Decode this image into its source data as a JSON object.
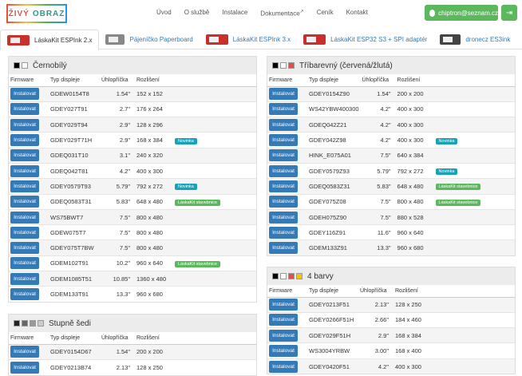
{
  "logo": {
    "part1": "ŽIVÝ",
    "part2": "OBRAZ"
  },
  "nav": [
    {
      "label": "Úvod"
    },
    {
      "label": "O službě"
    },
    {
      "label": "Instalace"
    },
    {
      "label": "Dokumentace",
      "external": true
    },
    {
      "label": "Ceník"
    },
    {
      "label": "Kontakt"
    }
  ],
  "user": {
    "email": "chiptron@seznam.cz"
  },
  "tabs": [
    {
      "label": "LáskaKit ESPInk 2.x",
      "board": "red",
      "active": true
    },
    {
      "label": "Pájeníčko Paperboard",
      "board": "gray"
    },
    {
      "label": "LáskaKit ESPInk 3.x",
      "board": "red"
    },
    {
      "label": "LáskaKit ESP32 S3 + SPI adaptér",
      "board": "red"
    },
    {
      "label": "dronecz ES3ink",
      "board": "dark"
    }
  ],
  "headers": {
    "firmware": "Firmware",
    "type": "Typ displeje",
    "diag": "Úhlopříčka",
    "res": "Rozlišení"
  },
  "install_label": "Instalovat",
  "panels": [
    {
      "id": "bw",
      "title": "Černobílý",
      "swatches": [
        "#000",
        "#fff"
      ],
      "rows": [
        {
          "type": "GDEW0154T8",
          "diag": "1.54\"",
          "res": "152 x 152",
          "badge": ""
        },
        {
          "type": "GDEY027T91",
          "diag": "2.7\"",
          "res": "176 x 264",
          "badge": ""
        },
        {
          "type": "GDEY029T94",
          "diag": "2.9\"",
          "res": "128 x 296",
          "badge": ""
        },
        {
          "type": "GDEY029T71H",
          "diag": "2.9\"",
          "res": "168 x 384",
          "badge": "Novinka"
        },
        {
          "type": "GDEQ031T10",
          "diag": "3.1\"",
          "res": "240 x 320",
          "badge": ""
        },
        {
          "type": "GDEQ042T81",
          "diag": "4.2\"",
          "res": "400 x 300",
          "badge": ""
        },
        {
          "type": "GDEY0579T93",
          "diag": "5.79\"",
          "res": "792 x 272",
          "badge": "Novinka"
        },
        {
          "type": "GDEQ0583T31",
          "diag": "5.83\"",
          "res": "648 x 480",
          "badge": "LáskaKit stavebnice"
        },
        {
          "type": "WS75BWT7",
          "diag": "7.5\"",
          "res": "800 x 480",
          "badge": ""
        },
        {
          "type": "GDEW075T7",
          "diag": "7.5\"",
          "res": "800 x 480",
          "badge": ""
        },
        {
          "type": "GDEY075T7BW",
          "diag": "7.5\"",
          "res": "800 x 480",
          "badge": ""
        },
        {
          "type": "GDEM102T91",
          "diag": "10.2\"",
          "res": "960 x 640",
          "badge": "LáskaKit stavebnice"
        },
        {
          "type": "GDEM1085T51",
          "diag": "10.85\"",
          "res": "1360 x 480",
          "badge": ""
        },
        {
          "type": "GDEM133T91",
          "diag": "13.3\"",
          "res": "960 x 680",
          "badge": ""
        }
      ]
    },
    {
      "id": "gray",
      "title": "Stupně šedi",
      "swatches": [
        "#222",
        "#666",
        "#999",
        "#ccc"
      ],
      "rows": [
        {
          "type": "GDEY0154D67",
          "diag": "1.54\"",
          "res": "200 x 200",
          "badge": ""
        },
        {
          "type": "GDEY0213B74",
          "diag": "2.13\"",
          "res": "128 x 250",
          "badge": ""
        }
      ]
    },
    {
      "id": "tri",
      "title": "Tříbarevný (červená/žlutá)",
      "swatches": [
        "#000",
        "#fff",
        "#d9534f"
      ],
      "rows": [
        {
          "type": "GDEY0154Z90",
          "diag": "1.54\"",
          "res": "200 x 200",
          "badge": ""
        },
        {
          "type": "WS42YBW400300",
          "diag": "4.2\"",
          "res": "400 x 300",
          "badge": ""
        },
        {
          "type": "GDEQ042Z21",
          "diag": "4.2\"",
          "res": "400 x 300",
          "badge": ""
        },
        {
          "type": "GDEY042Z98",
          "diag": "4.2\"",
          "res": "400 x 300",
          "badge": "Novinka"
        },
        {
          "type": "HINK_E075A01",
          "diag": "7.5\"",
          "res": "640 x 384",
          "badge": ""
        },
        {
          "type": "GDEY0579Z93",
          "diag": "5.79\"",
          "res": "792 x 272",
          "badge": "Novinka"
        },
        {
          "type": "GDEQ0583Z31",
          "diag": "5.83\"",
          "res": "648 x 480",
          "badge": "LáskaKit stavebnice"
        },
        {
          "type": "GDEY075Z08",
          "diag": "7.5\"",
          "res": "800 x 480",
          "badge": "LáskaKit stavebnice"
        },
        {
          "type": "GDEH075Z90",
          "diag": "7.5\"",
          "res": "880 x 528",
          "badge": ""
        },
        {
          "type": "GDEY116Z91",
          "diag": "11.6\"",
          "res": "960 x 640",
          "badge": ""
        },
        {
          "type": "GDEM133Z91",
          "diag": "13.3\"",
          "res": "960 x 680",
          "badge": ""
        }
      ]
    },
    {
      "id": "four",
      "title": "4 barvy",
      "swatches": [
        "#000",
        "#fff",
        "#d9534f",
        "#f0c419"
      ],
      "rows": [
        {
          "type": "GDEY0213F51",
          "diag": "2.13\"",
          "res": "128 x 250",
          "badge": ""
        },
        {
          "type": "GDEY0266F51H",
          "diag": "2.66\"",
          "res": "184 x 460",
          "badge": ""
        },
        {
          "type": "GDEY029F51H",
          "diag": "2.9\"",
          "res": "168 x 384",
          "badge": ""
        },
        {
          "type": "WS3004YRBW",
          "diag": "3.00\"",
          "res": "168 x 400",
          "badge": ""
        },
        {
          "type": "GDEY0420F51",
          "diag": "4.2\"",
          "res": "400 x 300",
          "badge": ""
        }
      ]
    }
  ]
}
